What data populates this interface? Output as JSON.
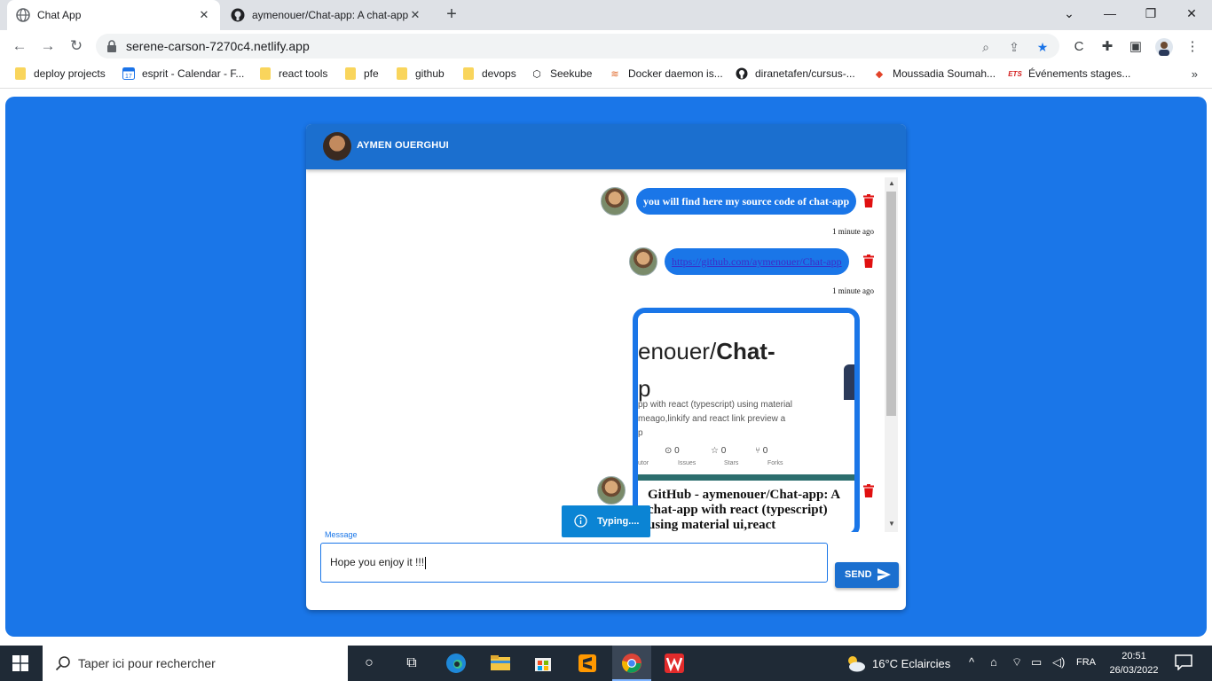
{
  "browser": {
    "tabs": [
      {
        "title": "Chat App",
        "active": true
      },
      {
        "title": "aymenouer/Chat-app: A chat-app",
        "active": false
      }
    ],
    "new_tab": "+",
    "window_controls": {
      "dropdown": "⌄",
      "minimize": "—",
      "restore": "❐",
      "close": "✕"
    },
    "url": "serene-carson-7270c4.netlify.app",
    "bookmarks": [
      {
        "label": "deploy projects",
        "icon": "folder-icon"
      },
      {
        "label": "esprit - Calendar - F...",
        "icon": "calendar-icon"
      },
      {
        "label": "react tools",
        "icon": "folder-icon"
      },
      {
        "label": "pfe",
        "icon": "folder-icon"
      },
      {
        "label": "github",
        "icon": "folder-icon"
      },
      {
        "label": "devops",
        "icon": "folder-icon"
      },
      {
        "label": "Seekube",
        "icon": "seekube-icon"
      },
      {
        "label": "Docker daemon is...",
        "icon": "docker-icon"
      },
      {
        "label": "diranetafen/cursus-...",
        "icon": "github-icon"
      },
      {
        "label": "Moussadia Soumah...",
        "icon": "gitlab-icon"
      },
      {
        "label": "Événements stages...",
        "icon": "ets-icon"
      }
    ],
    "bookmarks_more": "»"
  },
  "chat": {
    "header_name": "AYMEN OUERGHUI",
    "messages": [
      {
        "type": "text",
        "text": "you will find here my source code of chat-app",
        "time": "1 minute ago"
      },
      {
        "type": "link",
        "text": "https://github.com/aymenouer/Chat-app",
        "time": "1 minute ago"
      },
      {
        "type": "preview",
        "image": {
          "title_prefix": "enouer/",
          "title_bold": "Chat-",
          "title_line2": "p",
          "desc_lines": [
            "pp with react (typescript) using material",
            "meago,linkify and react link preview a",
            "p"
          ],
          "stats": [
            {
              "value": "0",
              "label": "Issues"
            },
            {
              "value": "0",
              "label": "Stars"
            },
            {
              "value": "0",
              "label": "Forks"
            }
          ],
          "contributors_label": "utor"
        },
        "title": "GitHub - aymenouer/Chat-app: A chat-app with react (typescript) using material ui,react"
      }
    ],
    "typing_text": "Typing....",
    "input": {
      "label": "Message",
      "value": "Hope you enjoy it !!!"
    },
    "send_label": "SEND",
    "colors": {
      "accent": "#1a76e8",
      "header": "#1b6fcf",
      "delete": "#e01010"
    }
  },
  "taskbar": {
    "search_placeholder": "Taper ici pour rechercher",
    "weather": "16°C  Eclaircies",
    "language": "FRA",
    "time": "20:51",
    "date": "26/03/2022"
  }
}
